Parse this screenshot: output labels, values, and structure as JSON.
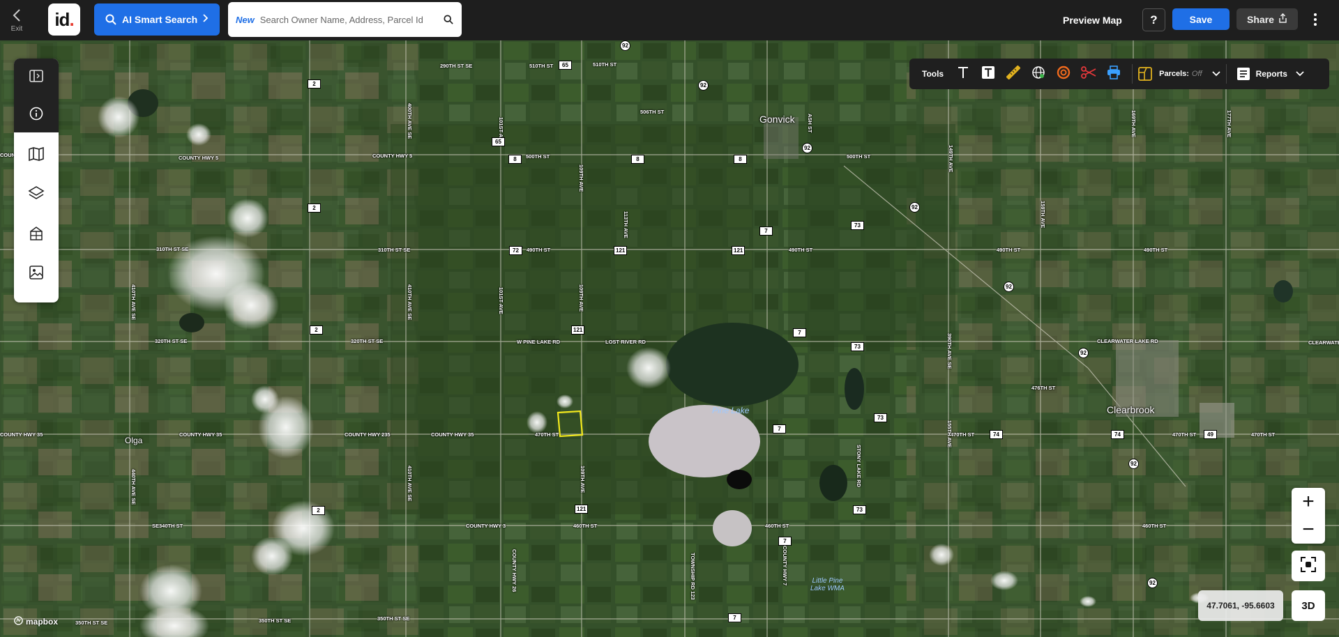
{
  "topbar": {
    "exit_label": "Exit",
    "logo_text": "id",
    "ai_search_label": "AI Smart Search",
    "search_new_badge": "New",
    "search_placeholder": "Search Owner Name, Address, Parcel Id",
    "preview_map_label": "Preview Map",
    "help_label": "?",
    "save_label": "Save",
    "share_label": "Share"
  },
  "toolbar": {
    "title": "Tools",
    "parcels_label": "Parcels:",
    "parcels_state": "Off",
    "reports_label": "Reports",
    "icons": [
      "text-icon",
      "text-box-icon",
      "ruler-icon",
      "globe-icon",
      "radius-icon",
      "scissors-icon",
      "print-icon",
      "parcels-icon",
      "reports-icon"
    ]
  },
  "left_panel": {
    "icons": [
      "toggle-panel-icon",
      "info-icon",
      "map-icon",
      "layers-icon",
      "buildings-icon",
      "image-icon"
    ]
  },
  "map": {
    "towns": [
      "Gonvick",
      "Clearbrook",
      "Olga"
    ],
    "lakes": [
      "Pine Lake"
    ],
    "wma": [
      "Little Pine",
      "Lake WMA"
    ],
    "road_labels": [
      "290TH ST SE",
      "510TH ST",
      "510TH ST",
      "506TH ST",
      "COUNTY HWY 5",
      "COUNTY HWY 5",
      "500TH ST",
      "500TH ST",
      "310TH ST SE",
      "310TH ST SE",
      "490TH ST",
      "490TH ST",
      "490TH ST",
      "490TH ST",
      "320TH ST SE",
      "320TH ST SE",
      "W PINE LAKE RD",
      "LOST RIVER RD",
      "CLEARWATER LAKE RD",
      "CLEARWATER",
      "476TH ST",
      "COUNTY HWY 35",
      "COUNTY HWY 35",
      "COUNTY HWY 235",
      "COUNTY HWY 35",
      "470TH ST",
      "470TH ST",
      "470TH ST",
      "470TH ST",
      "SE340TH ST",
      "COUNTY HWY 3",
      "460TH ST",
      "460TH ST",
      "460TH ST",
      "350TH ST SE",
      "350TH ST SE",
      "350TH ST SE",
      "COUNTY",
      "410TH AVE SE",
      "109TH AVE",
      "109TH AVE",
      "109TH AVE",
      "113TH AVE",
      "101ST AVE",
      "101ST AVE",
      "400TH AVE SE",
      "410TH AVE SE",
      "410TH AVE SE",
      "440TH AVE SE",
      "STONY LAKE RD",
      "155TH AVE",
      "149TH AVE",
      "159TH AVE",
      "169TH AVE",
      "177TH AVE",
      "COUNTY HWY 7",
      "COUNTY HWY 26",
      "TOWNSHIP RD 123",
      "ASH ST",
      "390TH AVE SE"
    ],
    "shields": [
      "65",
      "65",
      "2",
      "2",
      "2",
      "2",
      "8",
      "8",
      "8",
      "92",
      "92",
      "92",
      "92",
      "92",
      "92",
      "92",
      "92",
      "72",
      "121",
      "121",
      "121",
      "121",
      "7",
      "7",
      "7",
      "7",
      "7",
      "73",
      "73",
      "73",
      "73",
      "74",
      "74",
      "49"
    ],
    "coordinates": "47.7061, -95.6603",
    "attribution": "mapbox"
  },
  "controls": {
    "zoom_in": "+",
    "zoom_out": "−",
    "btn_3d": "3D"
  }
}
